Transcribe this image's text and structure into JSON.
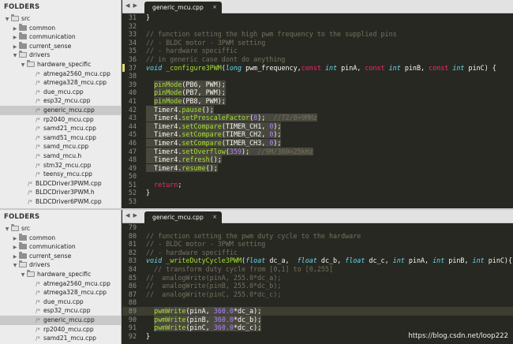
{
  "sidebar": {
    "header": "FOLDERS",
    "top_items": [
      {
        "label": "src",
        "indent": 0,
        "type": "folder-open",
        "arrow": "▼"
      },
      {
        "label": "common",
        "indent": 1,
        "type": "folder",
        "arrow": "▶"
      },
      {
        "label": "communication",
        "indent": 1,
        "type": "folder",
        "arrow": "▶"
      },
      {
        "label": "current_sense",
        "indent": 1,
        "type": "folder",
        "arrow": "▶"
      },
      {
        "label": "drivers",
        "indent": 1,
        "type": "folder-open",
        "arrow": "▼"
      },
      {
        "label": "hardware_specific",
        "indent": 2,
        "type": "folder-open",
        "arrow": "▼"
      },
      {
        "label": "atmega2560_mcu.cpp",
        "indent": 3,
        "type": "file"
      },
      {
        "label": "atmega328_mcu.cpp",
        "indent": 3,
        "type": "file"
      },
      {
        "label": "due_mcu.cpp",
        "indent": 3,
        "type": "file"
      },
      {
        "label": "esp32_mcu.cpp",
        "indent": 3,
        "type": "file"
      },
      {
        "label": "generic_mcu.cpp",
        "indent": 3,
        "type": "file",
        "selected": true
      },
      {
        "label": "rp2040_mcu.cpp",
        "indent": 3,
        "type": "file"
      },
      {
        "label": "samd21_mcu.cpp",
        "indent": 3,
        "type": "file"
      },
      {
        "label": "samd51_mcu.cpp",
        "indent": 3,
        "type": "file"
      },
      {
        "label": "samd_mcu.cpp",
        "indent": 3,
        "type": "file"
      },
      {
        "label": "samd_mcu.h",
        "indent": 3,
        "type": "file"
      },
      {
        "label": "stm32_mcu.cpp",
        "indent": 3,
        "type": "file"
      },
      {
        "label": "teensy_mcu.cpp",
        "indent": 3,
        "type": "file"
      },
      {
        "label": "BLDCDriver3PWM.cpp",
        "indent": 2,
        "type": "file"
      },
      {
        "label": "BLDCDriver3PWM.h",
        "indent": 2,
        "type": "file"
      },
      {
        "label": "BLDCDriver6PWM.cpp",
        "indent": 2,
        "type": "file"
      }
    ],
    "bottom_items": [
      {
        "label": "src",
        "indent": 0,
        "type": "folder-open",
        "arrow": "▼"
      },
      {
        "label": "common",
        "indent": 1,
        "type": "folder",
        "arrow": "▶"
      },
      {
        "label": "communication",
        "indent": 1,
        "type": "folder",
        "arrow": "▶"
      },
      {
        "label": "current_sense",
        "indent": 1,
        "type": "folder",
        "arrow": "▶"
      },
      {
        "label": "drivers",
        "indent": 1,
        "type": "folder-open",
        "arrow": "▼"
      },
      {
        "label": "hardware_specific",
        "indent": 2,
        "type": "folder-open",
        "arrow": "▼"
      },
      {
        "label": "atmega2560_mcu.cpp",
        "indent": 3,
        "type": "file"
      },
      {
        "label": "atmega328_mcu.cpp",
        "indent": 3,
        "type": "file"
      },
      {
        "label": "due_mcu.cpp",
        "indent": 3,
        "type": "file"
      },
      {
        "label": "esp32_mcu.cpp",
        "indent": 3,
        "type": "file"
      },
      {
        "label": "generic_mcu.cpp",
        "indent": 3,
        "type": "file",
        "selected": true
      },
      {
        "label": "rp2040_mcu.cpp",
        "indent": 3,
        "type": "file"
      },
      {
        "label": "samd21_mcu.cpp",
        "indent": 3,
        "type": "file"
      }
    ]
  },
  "tabs": {
    "nav": "◀ ▶",
    "top_tab": "generic_mcu.cpp",
    "bottom_tab": "generic_mcu.cpp",
    "close_glyph": "×"
  },
  "code_top": [
    {
      "num": "31",
      "segs": [
        [
          "t",
          "}"
        ]
      ]
    },
    {
      "num": "32",
      "segs": []
    },
    {
      "num": "33",
      "segs": [
        [
          "c",
          "// function setting the high pwm frequency to the supplied pins"
        ]
      ]
    },
    {
      "num": "34",
      "segs": [
        [
          "c",
          "// - BLDC motor - 3PWM setting"
        ]
      ]
    },
    {
      "num": "35",
      "segs": [
        [
          "c",
          "// - hardware speciffic"
        ]
      ]
    },
    {
      "num": "36",
      "segs": [
        [
          "c",
          "// in generic case dont do anything"
        ]
      ]
    },
    {
      "num": "37",
      "mod": true,
      "segs": [
        [
          "k",
          "void"
        ],
        [
          "t",
          " "
        ],
        [
          "fn",
          "_configure3PWM"
        ],
        [
          "t",
          "("
        ],
        [
          "k",
          "long"
        ],
        [
          "t",
          " pwm_frequency,"
        ],
        [
          "kw",
          "const"
        ],
        [
          "t",
          " "
        ],
        [
          "k",
          "int"
        ],
        [
          "t",
          " pinA, "
        ],
        [
          "kw",
          "const"
        ],
        [
          "t",
          " "
        ],
        [
          "k",
          "int"
        ],
        [
          "t",
          " pinB, "
        ],
        [
          "kw",
          "const"
        ],
        [
          "t",
          " "
        ],
        [
          "k",
          "int"
        ],
        [
          "t",
          " pinC) {"
        ]
      ]
    },
    {
      "num": "38",
      "segs": []
    },
    {
      "num": "39",
      "hl": true,
      "segs": [
        [
          "t",
          "  "
        ],
        [
          "fn",
          "pinMode"
        ],
        [
          "t",
          "(PB6, PWM);"
        ]
      ]
    },
    {
      "num": "40",
      "hl": true,
      "segs": [
        [
          "t",
          "  "
        ],
        [
          "fn",
          "pinMode"
        ],
        [
          "t",
          "(PB7, PWM);"
        ]
      ]
    },
    {
      "num": "41",
      "hl": true,
      "segs": [
        [
          "t",
          "  "
        ],
        [
          "fn",
          "pinMode"
        ],
        [
          "t",
          "(PB8, PWM);"
        ]
      ]
    },
    {
      "num": "42",
      "hl": true,
      "segs": [
        [
          "t",
          "  Timer4."
        ],
        [
          "fn",
          "pause"
        ],
        [
          "t",
          "();"
        ]
      ]
    },
    {
      "num": "43",
      "hl": true,
      "segs": [
        [
          "t",
          "  Timer4."
        ],
        [
          "fn",
          "setPrescaleFactor"
        ],
        [
          "t",
          "("
        ],
        [
          "n",
          "8"
        ],
        [
          "t",
          ");  "
        ],
        [
          "c",
          "//72/8=9MHz"
        ]
      ]
    },
    {
      "num": "44",
      "hl": true,
      "segs": [
        [
          "t",
          "  Timer4."
        ],
        [
          "fn",
          "setCompare"
        ],
        [
          "t",
          "(TIMER_CH1, "
        ],
        [
          "n",
          "0"
        ],
        [
          "t",
          ");"
        ]
      ]
    },
    {
      "num": "45",
      "hl": true,
      "segs": [
        [
          "t",
          "  Timer4."
        ],
        [
          "fn",
          "setCompare"
        ],
        [
          "t",
          "(TIMER_CH2, "
        ],
        [
          "n",
          "0"
        ],
        [
          "t",
          ");"
        ]
      ]
    },
    {
      "num": "46",
      "hl": true,
      "segs": [
        [
          "t",
          "  Timer4."
        ],
        [
          "fn",
          "setCompare"
        ],
        [
          "t",
          "(TIMER_CH3, "
        ],
        [
          "n",
          "0"
        ],
        [
          "t",
          ");"
        ]
      ]
    },
    {
      "num": "47",
      "hl": true,
      "segs": [
        [
          "t",
          "  Timer4."
        ],
        [
          "fn",
          "setOverflow"
        ],
        [
          "t",
          "("
        ],
        [
          "n",
          "359"
        ],
        [
          "t",
          ");  "
        ],
        [
          "c",
          "//9M/360=25kHz"
        ]
      ]
    },
    {
      "num": "48",
      "hl": true,
      "segs": [
        [
          "t",
          "  Timer4."
        ],
        [
          "fn",
          "refresh"
        ],
        [
          "t",
          "();"
        ]
      ]
    },
    {
      "num": "49",
      "hl": true,
      "segs": [
        [
          "t",
          "  Timer4."
        ],
        [
          "fn",
          "resume"
        ],
        [
          "t",
          "();"
        ]
      ]
    },
    {
      "num": "50",
      "segs": []
    },
    {
      "num": "51",
      "segs": [
        [
          "t",
          "  "
        ],
        [
          "kw",
          "return"
        ],
        [
          "t",
          ";"
        ]
      ]
    },
    {
      "num": "52",
      "segs": [
        [
          "t",
          "}"
        ]
      ]
    },
    {
      "num": "53",
      "segs": []
    }
  ],
  "code_bottom": [
    {
      "num": "79",
      "segs": []
    },
    {
      "num": "80",
      "segs": [
        [
          "c",
          "// function setting the pwm duty cycle to the hardware"
        ]
      ]
    },
    {
      "num": "81",
      "segs": [
        [
          "c",
          "// - BLDC motor - 3PWM setting"
        ]
      ]
    },
    {
      "num": "82",
      "segs": [
        [
          "c",
          "// - hardware speciffic"
        ]
      ]
    },
    {
      "num": "83",
      "segs": [
        [
          "k",
          "void"
        ],
        [
          "t",
          " "
        ],
        [
          "fn",
          "_writeDutyCycle3PWM"
        ],
        [
          "t",
          "("
        ],
        [
          "k",
          "float"
        ],
        [
          "t",
          " dc_a,  "
        ],
        [
          "k",
          "float"
        ],
        [
          "t",
          " dc_b, "
        ],
        [
          "k",
          "float"
        ],
        [
          "t",
          " dc_c, "
        ],
        [
          "k",
          "int"
        ],
        [
          "t",
          " pinA, "
        ],
        [
          "k",
          "int"
        ],
        [
          "t",
          " pinB, "
        ],
        [
          "k",
          "int"
        ],
        [
          "t",
          " pinC){"
        ]
      ]
    },
    {
      "num": "84",
      "segs": [
        [
          "c",
          "  // transform duty cycle from [0,1] to [0,255]"
        ]
      ]
    },
    {
      "num": "85",
      "segs": [
        [
          "c",
          "//  analogWrite(pinA, 255.0*dc_a);"
        ]
      ]
    },
    {
      "num": "86",
      "segs": [
        [
          "c",
          "//  analogWrite(pinB, 255.0*dc_b);"
        ]
      ]
    },
    {
      "num": "87",
      "segs": [
        [
          "c",
          "//  analogWrite(pinC, 255.0*dc_c);"
        ]
      ]
    },
    {
      "num": "88",
      "segs": []
    },
    {
      "num": "89",
      "hl": true,
      "cur": true,
      "segs": [
        [
          "t",
          "  "
        ],
        [
          "fn",
          "pwmWrite"
        ],
        [
          "t",
          "(pinA, "
        ],
        [
          "n",
          "360.0"
        ],
        [
          "t",
          "*dc_a);"
        ]
      ]
    },
    {
      "num": "90",
      "hl": true,
      "segs": [
        [
          "t",
          "  "
        ],
        [
          "fn",
          "pwmWrite"
        ],
        [
          "t",
          "(pinB, "
        ],
        [
          "n",
          "360.0"
        ],
        [
          "t",
          "*dc_b);"
        ]
      ]
    },
    {
      "num": "91",
      "hl": true,
      "segs": [
        [
          "t",
          "  "
        ],
        [
          "fn",
          "pwmWrite"
        ],
        [
          "t",
          "(pinC, "
        ],
        [
          "n",
          "360.0"
        ],
        [
          "t",
          "*dc_c);"
        ]
      ]
    },
    {
      "num": "92",
      "segs": [
        [
          "t",
          "}"
        ]
      ]
    }
  ],
  "watermark": "https://blog.csdn.net/loop222",
  "colors": {
    "editor_bg": "#272822",
    "comment": "#75715e",
    "keyword_type": "#66d9ef",
    "keyword": "#f92672",
    "function": "#a6e22e",
    "number": "#ae81ff",
    "sidebar_bg": "#ececec"
  }
}
